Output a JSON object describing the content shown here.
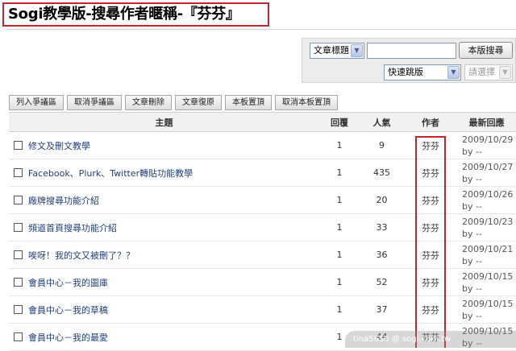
{
  "page_title": "Sogi教學版-搜尋作者暱稱-『芬芬』",
  "search": {
    "type_selected": "文章標題",
    "input_value": "",
    "search_button": "本版搜尋",
    "jump_selected": "快速跳版",
    "choose_selected": "請選擇"
  },
  "toolbar": [
    "列入爭議區",
    "取消爭議區",
    "文章刪除",
    "文章復原",
    "本板置頂",
    "取消本板置頂"
  ],
  "columns": {
    "subject": "主題",
    "replies": "回覆",
    "views": "人氣",
    "author": "作者",
    "latest": "最新回應"
  },
  "rows": [
    {
      "subject": "修文及刪文教學",
      "replies": "1",
      "views": "9",
      "author": "芬芬",
      "latest_date": "2009/10/29",
      "latest_by": "by --"
    },
    {
      "subject": "Facebook、Plurk、Twitter轉貼功能教學",
      "replies": "1",
      "views": "435",
      "author": "芬芬",
      "latest_date": "2009/10/27",
      "latest_by": "by --"
    },
    {
      "subject": "廠牌搜尋功能介紹",
      "replies": "1",
      "views": "20",
      "author": "芬芬",
      "latest_date": "2009/10/26",
      "latest_by": "by --"
    },
    {
      "subject": "頻道首頁搜尋功能介紹",
      "replies": "1",
      "views": "33",
      "author": "芬芬",
      "latest_date": "2009/10/23",
      "latest_by": "by --"
    },
    {
      "subject": "唉呀！我的文又被刪了？？",
      "replies": "1",
      "views": "36",
      "author": "芬芬",
      "latest_date": "2009/10/21",
      "latest_by": "by --"
    },
    {
      "subject": "會員中心－我的圖庫",
      "replies": "1",
      "views": "52",
      "author": "芬芬",
      "latest_date": "2009/10/15",
      "latest_by": "by --"
    },
    {
      "subject": "會員中心－我的草稿",
      "replies": "1",
      "views": "37",
      "author": "芬芬",
      "latest_date": "2009/10/15",
      "latest_by": "by --"
    },
    {
      "subject": "會員中心－我的最愛",
      "replies": "1",
      "views": "44",
      "author": "芬芬",
      "latest_date": "2009/10/15",
      "latest_by": "by --"
    }
  ],
  "watermark": "tina5656 @ sogi.com.tw"
}
